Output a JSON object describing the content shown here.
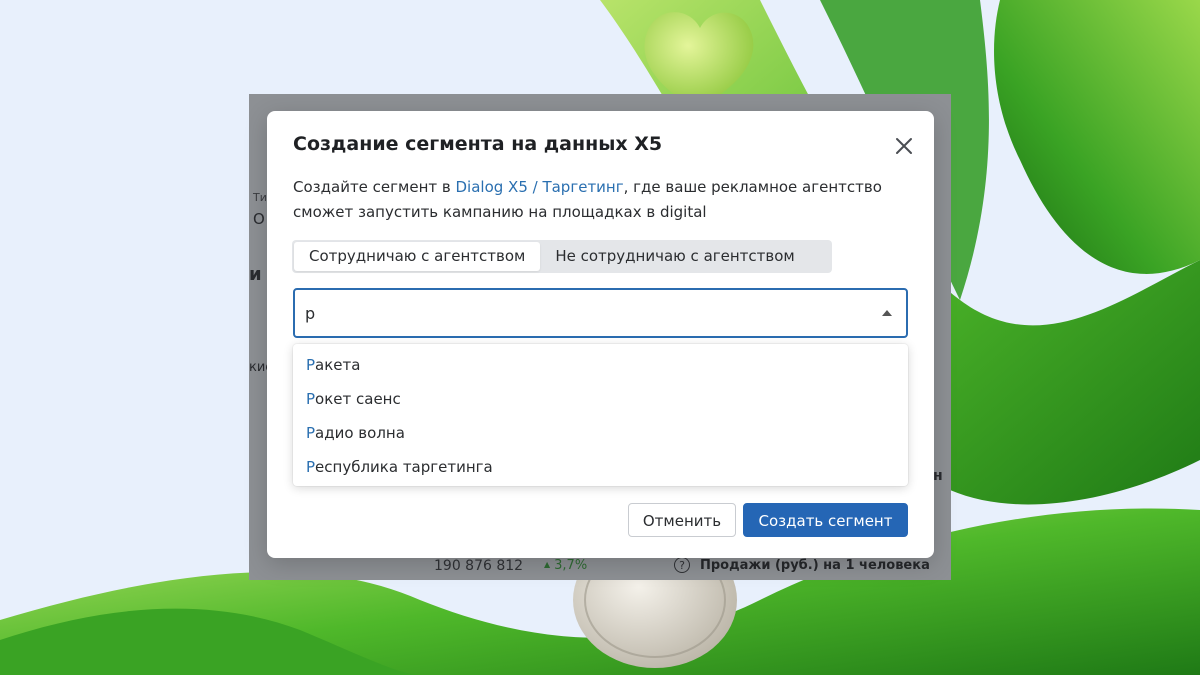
{
  "modal": {
    "title": "Создание сегмента на данных X5",
    "description_before": "Создайте сегмент в ",
    "description_link": "Dialog X5 / Таргетинг",
    "description_after": ", где ваше рекламное агентство сможет запустить кампанию на площадках в digital",
    "segment_options": [
      {
        "label": "Сотрудничаю с агентством",
        "active": true
      },
      {
        "label": "Не сотрудничаю с агентством",
        "active": false
      }
    ],
    "search": {
      "value": "р",
      "placeholder": ""
    },
    "suggestions": [
      {
        "match": "Р",
        "rest": "акета"
      },
      {
        "match": "Р",
        "rest": "окет саенс"
      },
      {
        "match": "Р",
        "rest": "адио волна"
      },
      {
        "match": "Р",
        "rest": "еспублика таргетинга"
      }
    ],
    "cancel_label": "Отменить",
    "create_label": "Создать сегмент"
  },
  "background_app": {
    "fragments": [
      "Ти",
      "О",
      "и",
      "кие",
      "н"
    ],
    "metric_value": "190 876 812",
    "metric_delta": "3,7%",
    "metric_label": "Продажи (руб.) на 1 человека"
  },
  "colors": {
    "accent": "#2566b5",
    "link": "#2a6fb0",
    "overlay": "#8d9094",
    "page_bg": "#e8f0fc"
  },
  "icons": [
    "close-icon",
    "dropdown-arrow-icon",
    "help-icon",
    "heart-decoration",
    "coin-decoration",
    "ribbon-decoration"
  ]
}
